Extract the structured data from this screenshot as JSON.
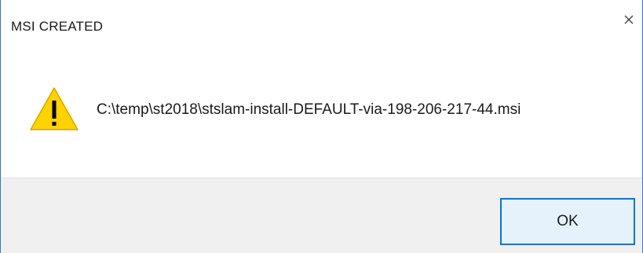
{
  "dialog": {
    "title": "MSI CREATED",
    "close_icon": "close-icon",
    "message": "C:\\temp\\st2018\\stslam-install-DEFAULT-via-198-206-217-44.msi",
    "message_icon": "warning-icon",
    "ok_label": "OK"
  },
  "colors": {
    "accent": "#0078d7",
    "window_border": "#2b78d1",
    "button_bg": "#e5f1fb",
    "footer_bg": "#f0f0f0",
    "warning_fill": "#ffd200"
  }
}
